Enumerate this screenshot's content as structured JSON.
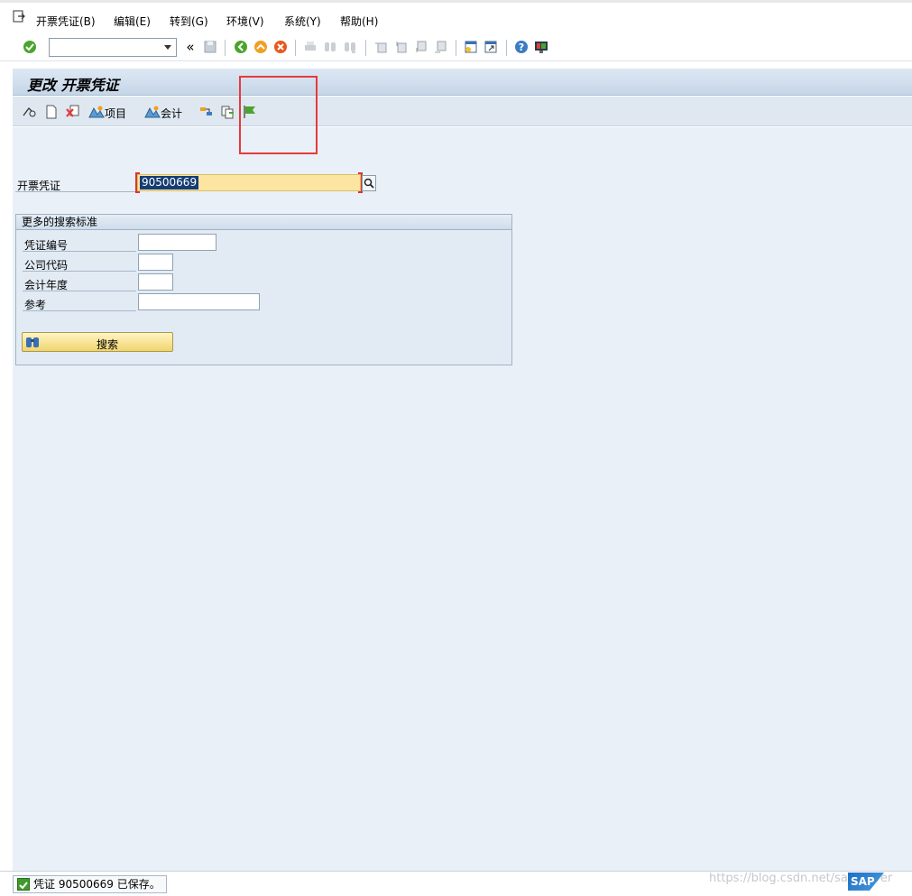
{
  "menubar": {
    "items": [
      "开票凭证(B)",
      "编辑(E)",
      "转到(G)",
      "环境(V)",
      "系统(Y)",
      "帮助(H)"
    ]
  },
  "system_toolbar": {
    "command_field_value": "",
    "icons": [
      "enter-icon",
      "back-double-icon",
      "save-icon",
      "back-icon",
      "exit-icon",
      "cancel-icon",
      "print-icon",
      "find-icon",
      "find-next-icon",
      "first-page-icon",
      "prev-page-icon",
      "next-page-icon",
      "last-page-icon",
      "new-session-icon",
      "shortcut-icon",
      "help-icon",
      "customize-layout-icon"
    ]
  },
  "title": "更改 开票凭证",
  "app_toolbar": {
    "items_label": "项目",
    "accounting_label": "会计",
    "icons": [
      "display-change-icon",
      "new-document-icon",
      "cancel-document-icon",
      "items-icon",
      "accounting-icon",
      "split-icon",
      "copy-icon",
      "flag-icon"
    ]
  },
  "main_field": {
    "label": "开票凭证",
    "value": "90500669"
  },
  "search_group": {
    "title": "更多的搜索标准",
    "fields": [
      {
        "label": "凭证编号",
        "value": ""
      },
      {
        "label": "公司代码",
        "value": ""
      },
      {
        "label": "会计年度",
        "value": ""
      },
      {
        "label": "参考",
        "value": ""
      }
    ],
    "button_label": "搜索"
  },
  "status": {
    "message": "凭证 90500669 已保存。"
  },
  "watermark": "https://blog.csdn.net/sapserver",
  "colors": {
    "accent_red": "#e63a3a",
    "title_gradient_top": "#dde8f4",
    "work_area": "#e9f0f7",
    "input_highlight": "#fbe5a0",
    "selection": "#153d73"
  }
}
